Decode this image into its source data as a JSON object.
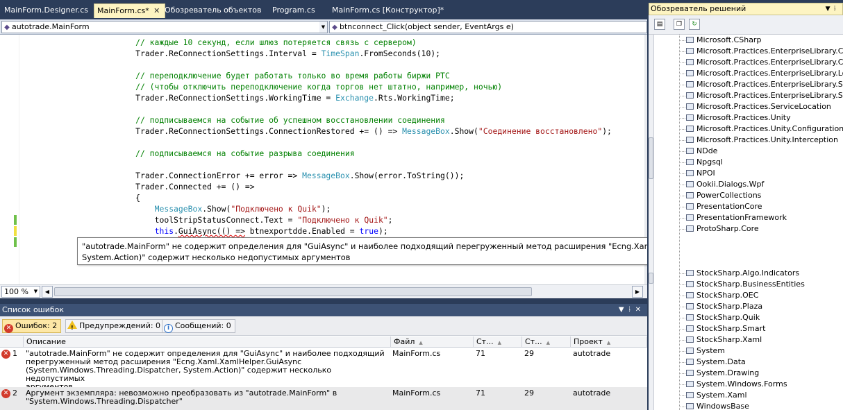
{
  "tabs": [
    {
      "label": "MainForm.Designer.cs",
      "active": false
    },
    {
      "label": "MainForm.cs*",
      "active": true
    },
    {
      "label": "Обозреватель объектов",
      "active": false
    },
    {
      "label": "Program.cs",
      "active": false
    },
    {
      "label": "MainForm.cs [Конструктор]*",
      "active": false
    }
  ],
  "navbar": {
    "type_combo": "autotrade.MainForm",
    "member_combo": "btnconnect_Click(object sender, EventArgs e)"
  },
  "code_lines": [
    {
      "i": 24,
      "t": [
        {
          "c": "cm",
          "s": "// каждые 10 секунд, если шлюз потеряется связь с сервером)"
        }
      ]
    },
    {
      "i": 24,
      "t": [
        {
          "c": "",
          "s": "Trader.ReConnectionSettings.Interval = "
        },
        {
          "c": "ty",
          "s": "TimeSpan"
        },
        {
          "c": "",
          "s": ".FromSeconds(10);"
        }
      ]
    },
    {
      "i": 0,
      "t": []
    },
    {
      "i": 24,
      "t": [
        {
          "c": "cm",
          "s": "// переподключение будет работать только во время работы биржи РТС"
        }
      ]
    },
    {
      "i": 24,
      "t": [
        {
          "c": "cm",
          "s": "// (чтобы отключить переподключение когда торгов нет штатно, например, ночью)"
        }
      ]
    },
    {
      "i": 24,
      "t": [
        {
          "c": "",
          "s": "Trader.ReConnectionSettings.WorkingTime = "
        },
        {
          "c": "ty",
          "s": "Exchange"
        },
        {
          "c": "",
          "s": ".Rts.WorkingTime;"
        }
      ]
    },
    {
      "i": 0,
      "t": []
    },
    {
      "i": 24,
      "t": [
        {
          "c": "cm",
          "s": "// подписываемся на событие об успешном восстановлении соединения"
        }
      ]
    },
    {
      "i": 24,
      "t": [
        {
          "c": "",
          "s": "Trader.ReConnectionSettings.ConnectionRestored += () => "
        },
        {
          "c": "ty",
          "s": "MessageBox"
        },
        {
          "c": "",
          "s": ".Show("
        },
        {
          "c": "st",
          "s": "\"Соединение восстановлено\""
        },
        {
          "c": "",
          "s": ");"
        }
      ]
    },
    {
      "i": 0,
      "t": []
    },
    {
      "i": 24,
      "t": [
        {
          "c": "cm",
          "s": "// подписываемся на событие разрыва соединения"
        }
      ]
    },
    {
      "i": 0,
      "t": []
    },
    {
      "i": 24,
      "t": [
        {
          "c": "",
          "s": "Trader.ConnectionError += error => "
        },
        {
          "c": "ty",
          "s": "MessageBox"
        },
        {
          "c": "",
          "s": ".Show(error.ToString());"
        }
      ]
    },
    {
      "i": 24,
      "t": [
        {
          "c": "",
          "s": "Trader.Connected += () =>"
        }
      ]
    },
    {
      "i": 24,
      "t": [
        {
          "c": "",
          "s": "{"
        }
      ]
    },
    {
      "i": 28,
      "t": [
        {
          "c": "ty",
          "s": "MessageBox"
        },
        {
          "c": "",
          "s": ".Show("
        },
        {
          "c": "st",
          "s": "\"Подключено к Quik\""
        },
        {
          "c": "",
          "s": ");"
        }
      ]
    },
    {
      "i": 28,
      "t": [
        {
          "c": "",
          "s": "toolStripStatusConnect.Text = "
        },
        {
          "c": "st",
          "s": "\"Подключено к Quik\""
        },
        {
          "c": "",
          "s": ";"
        }
      ]
    },
    {
      "i": 28,
      "t": [
        {
          "c": "kw",
          "s": "this"
        },
        {
          "c": "",
          "s": "."
        },
        {
          "c": "squig",
          "s": "GuiAsync(() =>"
        },
        {
          "c": "",
          "s": " btnexportdde.Enabled = "
        },
        {
          "c": "kw",
          "s": "true"
        },
        {
          "c": "",
          "s": ");"
        }
      ]
    }
  ],
  "tooltip": {
    "line1": "\"autotrade.MainForm\" не содержит определения для \"GuiAsync\" и наиболее подходящий перегруженный метод расширения \"Ecng.Xaml.XamlHelper.GuiAsync(System.Windows.Threading.Dispatcher,",
    "line2": "System.Action)\" содержит несколько недопустимых аргументов"
  },
  "zoom": "100 %",
  "error_list": {
    "title": "Список ошибок",
    "filters": {
      "errors": "Ошибок: 2",
      "warnings": "Предупреждений: 0",
      "messages": "Сообщений: 0"
    },
    "columns": {
      "description": "Описание",
      "file": "Файл",
      "line": "Ст...",
      "col": "Ст...",
      "project": "Проект"
    },
    "rows": [
      {
        "num": "1",
        "description": "\"autotrade.MainForm\" не содержит определения для \"GuiAsync\" и наиболее подходящий\nперегруженный метод расширения \"Ecng.Xaml.XamlHelper.GuiAsync\n(System.Windows.Threading.Dispatcher, System.Action)\" содержит несколько недопустимых\nаргументов",
        "file": "MainForm.cs",
        "line": "71",
        "col": "29",
        "project": "autotrade"
      },
      {
        "num": "2",
        "description": "Аргумент экземпляра: невозможно преобразовать из \"autotrade.MainForm\" в\n\"System.Windows.Threading.Dispatcher\"",
        "file": "MainForm.cs",
        "line": "71",
        "col": "29",
        "project": "autotrade"
      }
    ]
  },
  "solution_explorer": {
    "title": "Обозреватель решений",
    "references": [
      "Microsoft.CSharp",
      "Microsoft.Practices.EnterpriseLibrary.Common",
      "Microsoft.Practices.EnterpriseLibrary.Configuration",
      "Microsoft.Practices.EnterpriseLibrary.Logging",
      "Microsoft.Practices.EnterpriseLibrary.Security",
      "Microsoft.Practices.EnterpriseLibrary.Security.Cache",
      "Microsoft.Practices.ServiceLocation",
      "Microsoft.Practices.Unity",
      "Microsoft.Practices.Unity.Configuration",
      "Microsoft.Practices.Unity.Interception",
      "NDde",
      "Npgsql",
      "NPOI",
      "Ookii.Dialogs.Wpf",
      "PowerCollections",
      "PresentationCore",
      "PresentationFramework",
      "ProtoSharp.Core"
    ],
    "references_lower": [
      "StockSharp.Algo.Indicators",
      "StockSharp.BusinessEntities",
      "StockSharp.OEC",
      "StockSharp.Plaza",
      "StockSharp.Quik",
      "StockSharp.Smart",
      "StockSharp.Xaml",
      "System",
      "System.Data",
      "System.Drawing",
      "System.Windows.Forms",
      "System.Xaml",
      "WindowsBase"
    ]
  }
}
